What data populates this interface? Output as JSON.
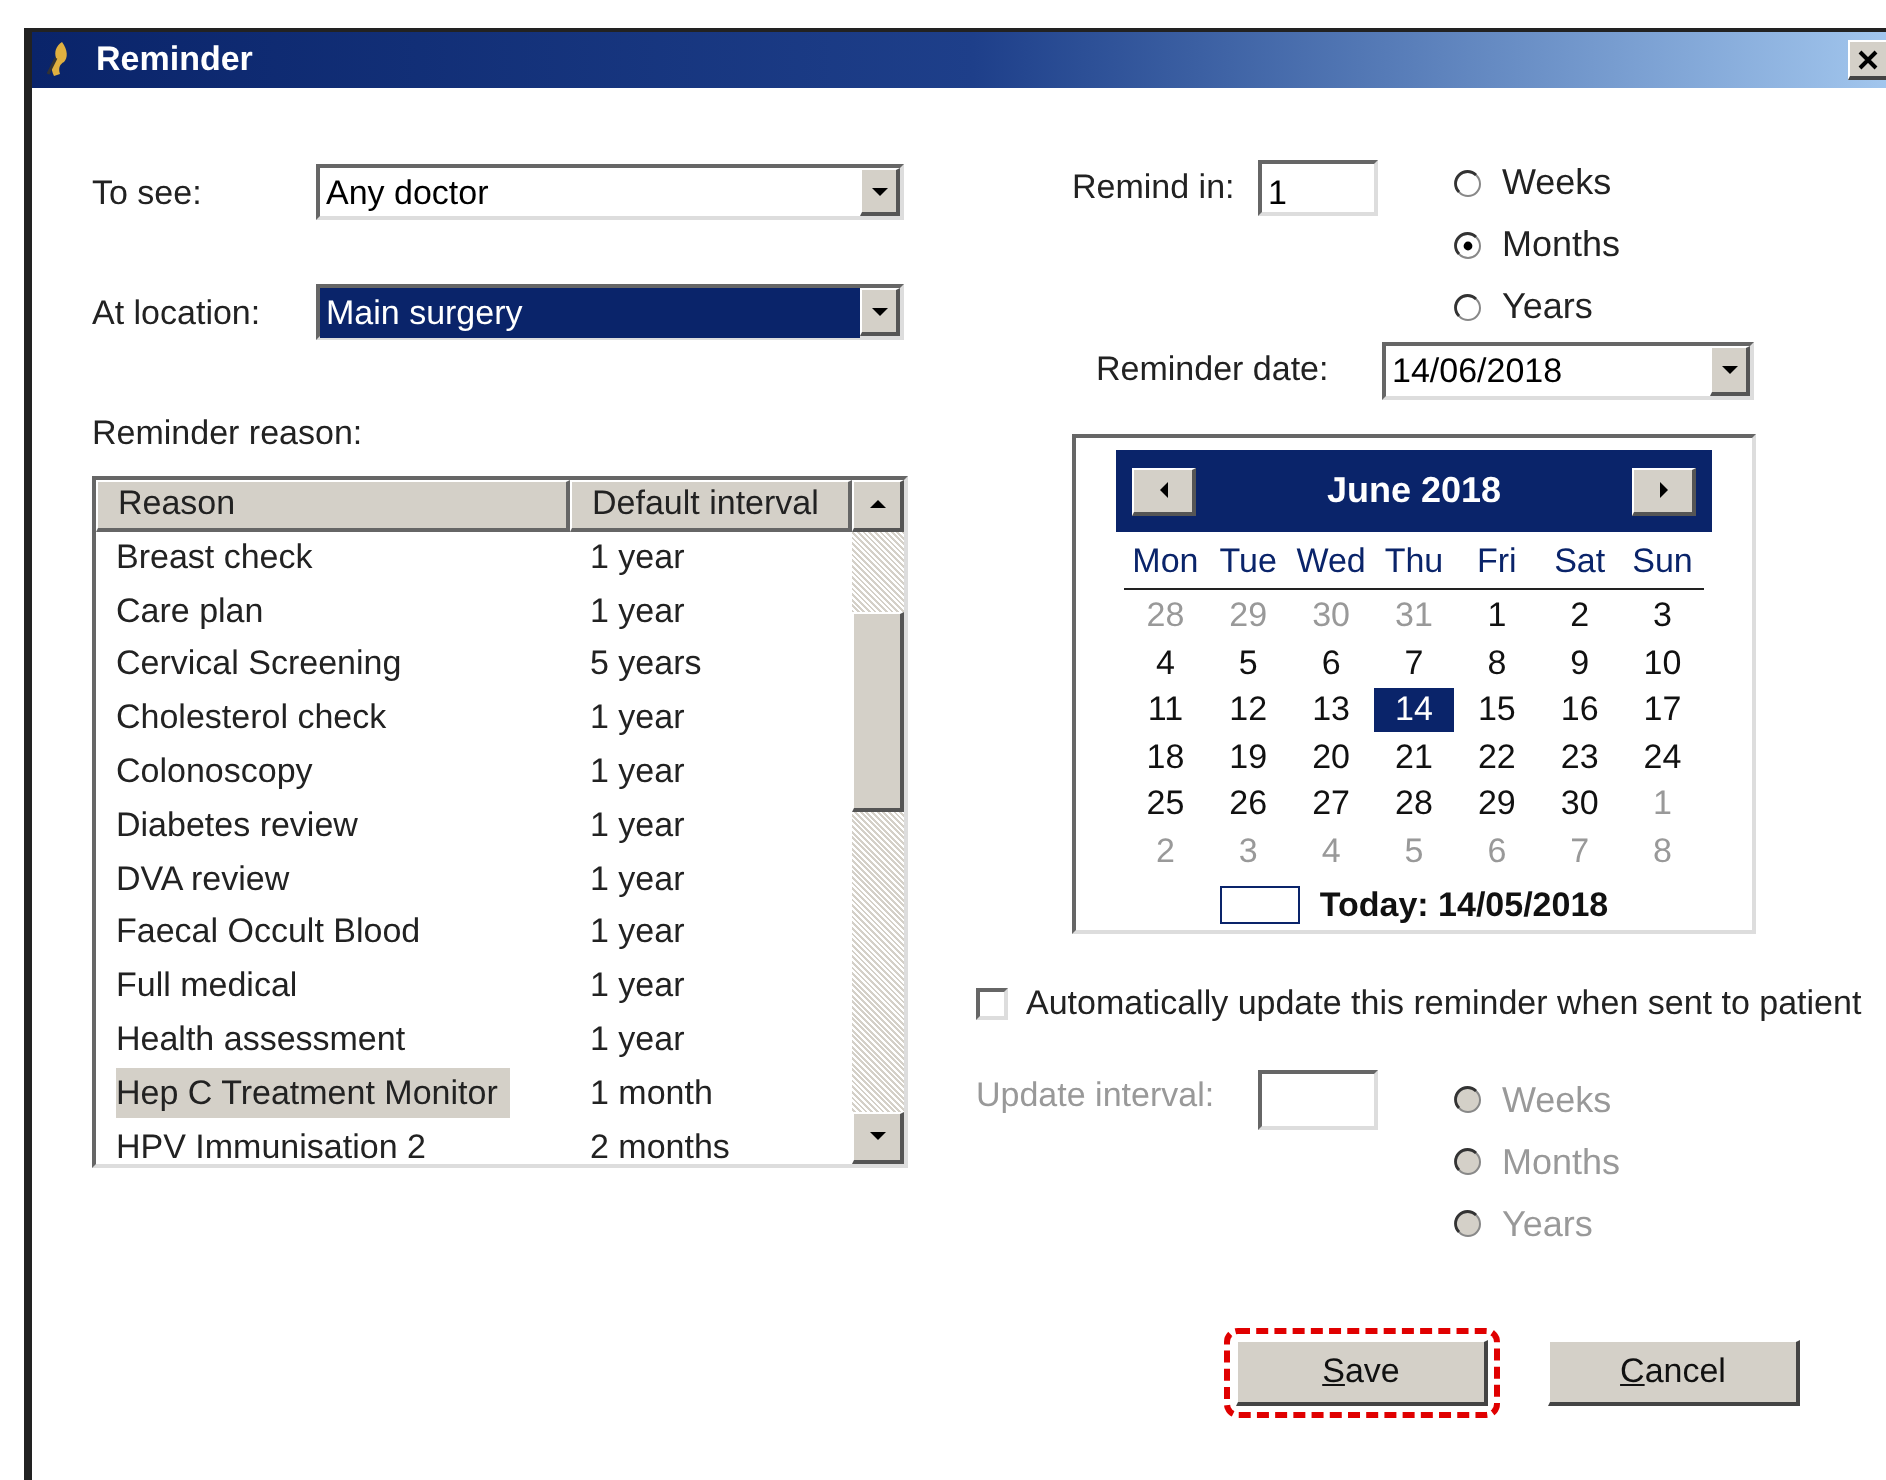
{
  "window": {
    "title": "Reminder"
  },
  "to_see": {
    "label": "To see:",
    "value": "Any doctor",
    "focused": false
  },
  "at_location": {
    "label": "At location:",
    "value": "Main surgery",
    "focused": true
  },
  "reason_list": {
    "label": "Reminder reason:",
    "columns": [
      "Reason",
      "Default interval"
    ],
    "rows": [
      {
        "reason": "Breast check",
        "interval": "1 year",
        "selected": false
      },
      {
        "reason": "Care plan",
        "interval": "1 year",
        "selected": false
      },
      {
        "reason": "Cervical Screening",
        "interval": "5 years",
        "selected": false
      },
      {
        "reason": "Cholesterol check",
        "interval": "1 year",
        "selected": false
      },
      {
        "reason": "Colonoscopy",
        "interval": "1 year",
        "selected": false
      },
      {
        "reason": "Diabetes review",
        "interval": "1 year",
        "selected": false
      },
      {
        "reason": "DVA review",
        "interval": "1 year",
        "selected": false
      },
      {
        "reason": "Faecal Occult Blood",
        "interval": "1 year",
        "selected": false
      },
      {
        "reason": "Full medical",
        "interval": "1 year",
        "selected": false
      },
      {
        "reason": "Health assessment",
        "interval": "1 year",
        "selected": false
      },
      {
        "reason": "Hep C Treatment Monitor",
        "interval": "1 month",
        "selected": true
      },
      {
        "reason": "HPV Immunisation 2",
        "interval": "2 months",
        "selected": false
      }
    ]
  },
  "remind_in": {
    "label": "Remind in:",
    "value": "1",
    "units": [
      {
        "label": "Weeks",
        "selected": false
      },
      {
        "label": "Months",
        "selected": true
      },
      {
        "label": "Years",
        "selected": false
      }
    ]
  },
  "reminder_date": {
    "label": "Reminder date:",
    "value": "14/06/2018"
  },
  "calendar": {
    "month_label": "June 2018",
    "weekdays": [
      "Mon",
      "Tue",
      "Wed",
      "Thu",
      "Fri",
      "Sat",
      "Sun"
    ],
    "weeks": [
      [
        {
          "day": "28",
          "other_month": true,
          "selected": false
        },
        {
          "day": "29",
          "other_month": true,
          "selected": false
        },
        {
          "day": "30",
          "other_month": true,
          "selected": false
        },
        {
          "day": "31",
          "other_month": true,
          "selected": false
        },
        {
          "day": "1",
          "other_month": false,
          "selected": false
        },
        {
          "day": "2",
          "other_month": false,
          "selected": false
        },
        {
          "day": "3",
          "other_month": false,
          "selected": false
        }
      ],
      [
        {
          "day": "4",
          "other_month": false,
          "selected": false
        },
        {
          "day": "5",
          "other_month": false,
          "selected": false
        },
        {
          "day": "6",
          "other_month": false,
          "selected": false
        },
        {
          "day": "7",
          "other_month": false,
          "selected": false
        },
        {
          "day": "8",
          "other_month": false,
          "selected": false
        },
        {
          "day": "9",
          "other_month": false,
          "selected": false
        },
        {
          "day": "10",
          "other_month": false,
          "selected": false
        }
      ],
      [
        {
          "day": "11",
          "other_month": false,
          "selected": false
        },
        {
          "day": "12",
          "other_month": false,
          "selected": false
        },
        {
          "day": "13",
          "other_month": false,
          "selected": false
        },
        {
          "day": "14",
          "other_month": false,
          "selected": true
        },
        {
          "day": "15",
          "other_month": false,
          "selected": false
        },
        {
          "day": "16",
          "other_month": false,
          "selected": false
        },
        {
          "day": "17",
          "other_month": false,
          "selected": false
        }
      ],
      [
        {
          "day": "18",
          "other_month": false,
          "selected": false
        },
        {
          "day": "19",
          "other_month": false,
          "selected": false
        },
        {
          "day": "20",
          "other_month": false,
          "selected": false
        },
        {
          "day": "21",
          "other_month": false,
          "selected": false
        },
        {
          "day": "22",
          "other_month": false,
          "selected": false
        },
        {
          "day": "23",
          "other_month": false,
          "selected": false
        },
        {
          "day": "24",
          "other_month": false,
          "selected": false
        }
      ],
      [
        {
          "day": "25",
          "other_month": false,
          "selected": false
        },
        {
          "day": "26",
          "other_month": false,
          "selected": false
        },
        {
          "day": "27",
          "other_month": false,
          "selected": false
        },
        {
          "day": "28",
          "other_month": false,
          "selected": false
        },
        {
          "day": "29",
          "other_month": false,
          "selected": false
        },
        {
          "day": "30",
          "other_month": false,
          "selected": false
        },
        {
          "day": "1",
          "other_month": true,
          "selected": false
        }
      ],
      [
        {
          "day": "2",
          "other_month": true,
          "selected": false
        },
        {
          "day": "3",
          "other_month": true,
          "selected": false
        },
        {
          "day": "4",
          "other_month": true,
          "selected": false
        },
        {
          "day": "5",
          "other_month": true,
          "selected": false
        },
        {
          "day": "6",
          "other_month": true,
          "selected": false
        },
        {
          "day": "7",
          "other_month": true,
          "selected": false
        },
        {
          "day": "8",
          "other_month": true,
          "selected": false
        }
      ]
    ],
    "today_label": "Today: 14/05/2018"
  },
  "auto_update": {
    "label": "Automatically update this reminder when sent to patient",
    "checked": false
  },
  "update_interval": {
    "label": "Update interval:",
    "disabled": true,
    "units": [
      {
        "label": "Weeks",
        "selected": false
      },
      {
        "label": "Months",
        "selected": false
      },
      {
        "label": "Years",
        "selected": false
      }
    ]
  },
  "buttons": [
    {
      "label": "Save",
      "highlighted": true
    },
    {
      "label": "Cancel",
      "highlighted": false
    }
  ]
}
